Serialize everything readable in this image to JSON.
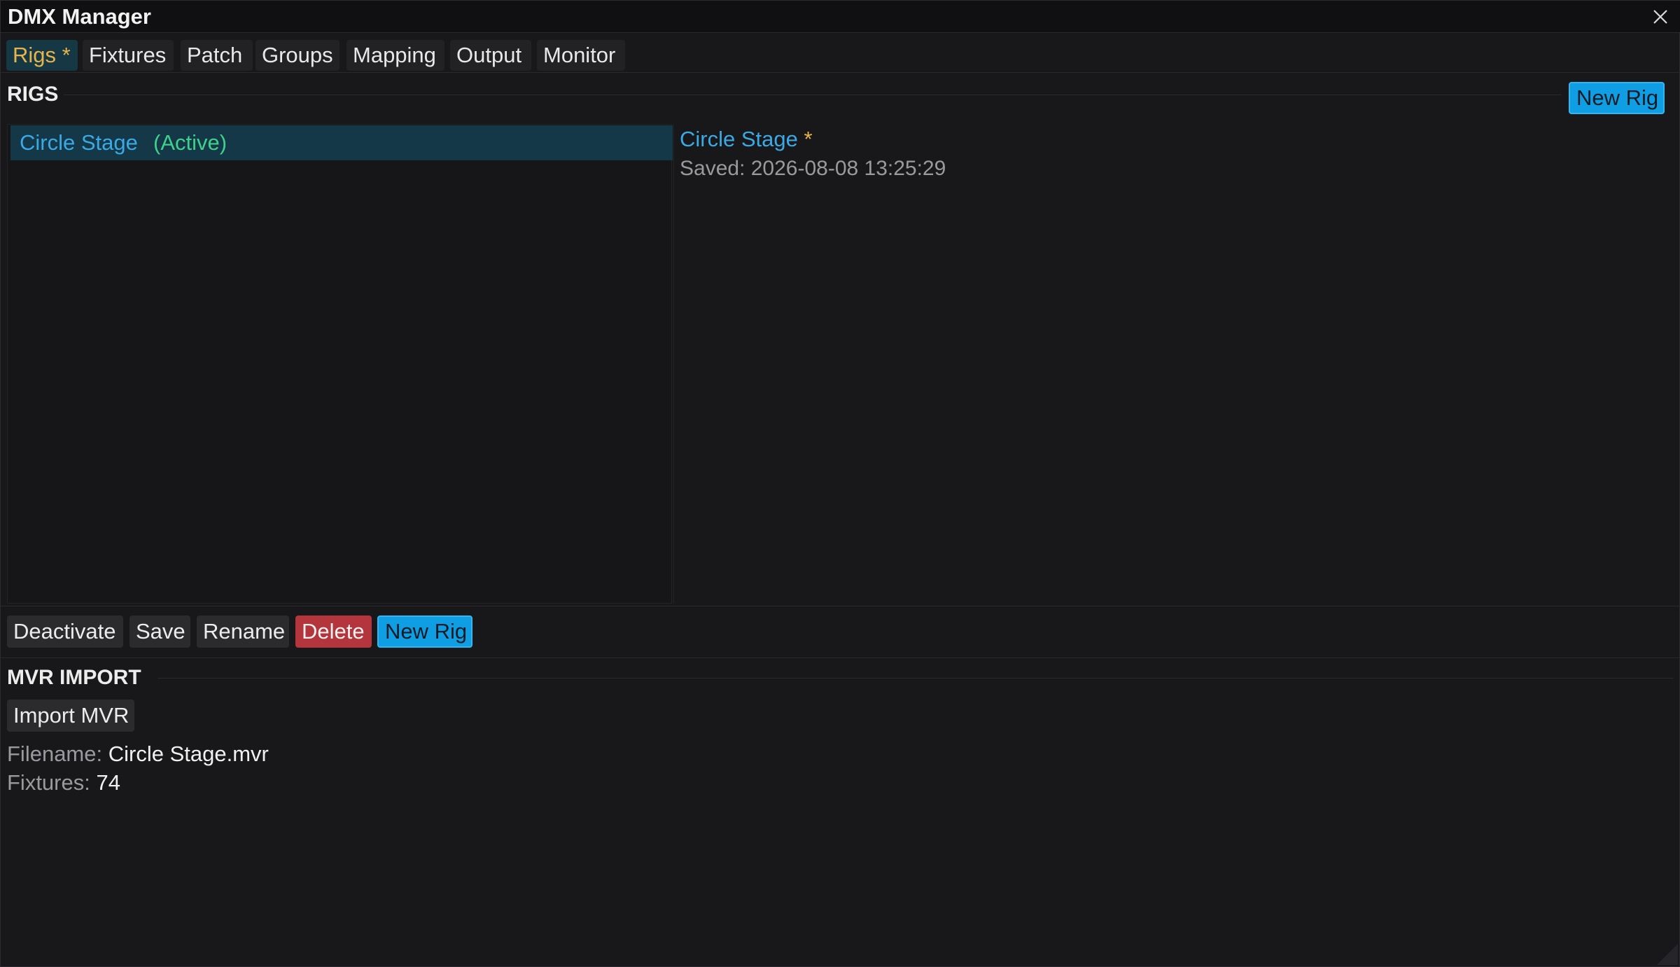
{
  "window": {
    "title": "DMX Manager"
  },
  "tabs": [
    {
      "label": "Rigs",
      "dirty_marker": "*"
    },
    {
      "label": "Fixtures"
    },
    {
      "label": "Patch"
    },
    {
      "label": "Groups"
    },
    {
      "label": "Mapping"
    },
    {
      "label": "Output"
    },
    {
      "label": "Monitor"
    }
  ],
  "rigs_section": {
    "header": "RIGS",
    "new_rig_label": "New Rig",
    "list": [
      {
        "name": "Circle Stage",
        "status": "(Active)"
      }
    ],
    "detail": {
      "name": "Circle Stage",
      "dirty_marker": "*",
      "saved": "Saved: 2026-08-08 13:25:29"
    },
    "actions": {
      "deactivate": "Deactivate",
      "save": "Save",
      "rename": "Rename",
      "delete": "Delete",
      "new_rig": "New Rig"
    }
  },
  "mvr_section": {
    "header": "MVR IMPORT",
    "import_label": "Import MVR",
    "filename_label": "Filename:",
    "filename_value": "Circle Stage.mvr",
    "fixtures_label": "Fixtures:",
    "fixtures_value": "74"
  },
  "colors": {
    "accent_blue": "#0f9ee3",
    "active_green": "#3fd08c",
    "dirty_yellow": "#e7b34b",
    "danger_red": "#b4353b"
  }
}
